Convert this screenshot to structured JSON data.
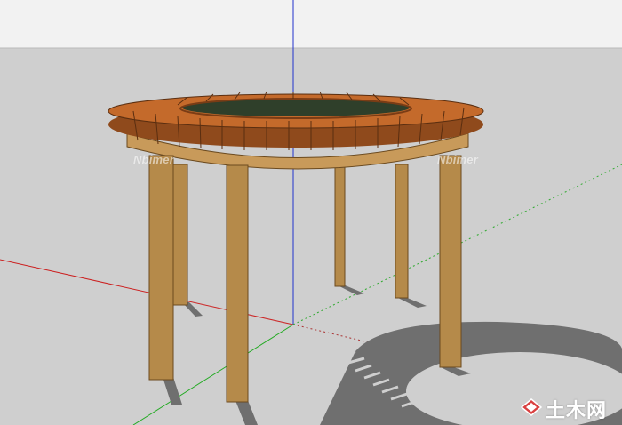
{
  "watermark": {
    "left": "Nbimer",
    "right": "Nbimer"
  },
  "logo": {
    "text": "土木网",
    "icon": "diamond-logo-icon"
  },
  "colors": {
    "sky": "#f2f2f2",
    "ground": "#cfcfcf",
    "wood_top": "#c46a2b",
    "wood_dark": "#8f4a1c",
    "frame": "#c89a5a",
    "leg": "#b58a4a",
    "shadow": "#6f6f6f",
    "axis_red": "#cc2222",
    "axis_green": "#22aa22",
    "axis_blue": "#2233cc"
  }
}
